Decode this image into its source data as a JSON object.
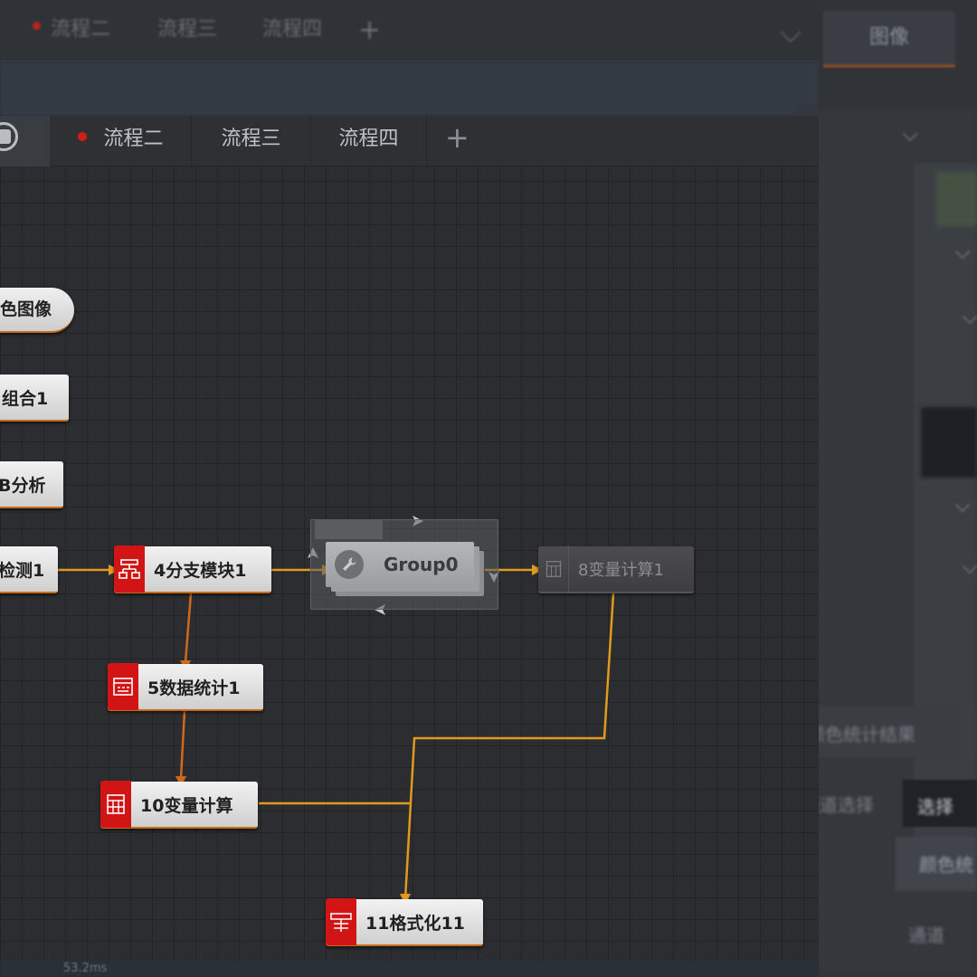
{
  "ghost_tabs": [
    "流程二",
    "流程三",
    "流程四"
  ],
  "ghost_image_tab": "图像",
  "right_panel": {
    "section_title": "颜色统计结果",
    "channel_select_label": "通道选择",
    "channel_select_value": "选择",
    "result_label": "颜色统",
    "bottom_label": "通道"
  },
  "editor_tabs": [
    {
      "label": "流程二",
      "modified": true
    },
    {
      "label": "流程三",
      "modified": false
    },
    {
      "label": "流程四",
      "modified": false
    }
  ],
  "nodes": {
    "input_image": "色图像",
    "combine": "组合1",
    "analysis": "B分析",
    "detect": "检测1",
    "branch": "4分支模块1",
    "data_stats": "5数据统计1",
    "var_calc": "10变量计算",
    "var_calc_disabled": "8变量计算1",
    "format": "11格式化11"
  },
  "group": {
    "label": "Group0"
  },
  "status_bar": {
    "time_label": "...",
    "time_value": "53.2ms",
    "count_label": "...",
    "count_value": "..."
  },
  "colors": {
    "accent": "#c76c18",
    "node_badge": "#d11515",
    "wire": "#e09a1e",
    "wire_down": "#d0691a"
  }
}
